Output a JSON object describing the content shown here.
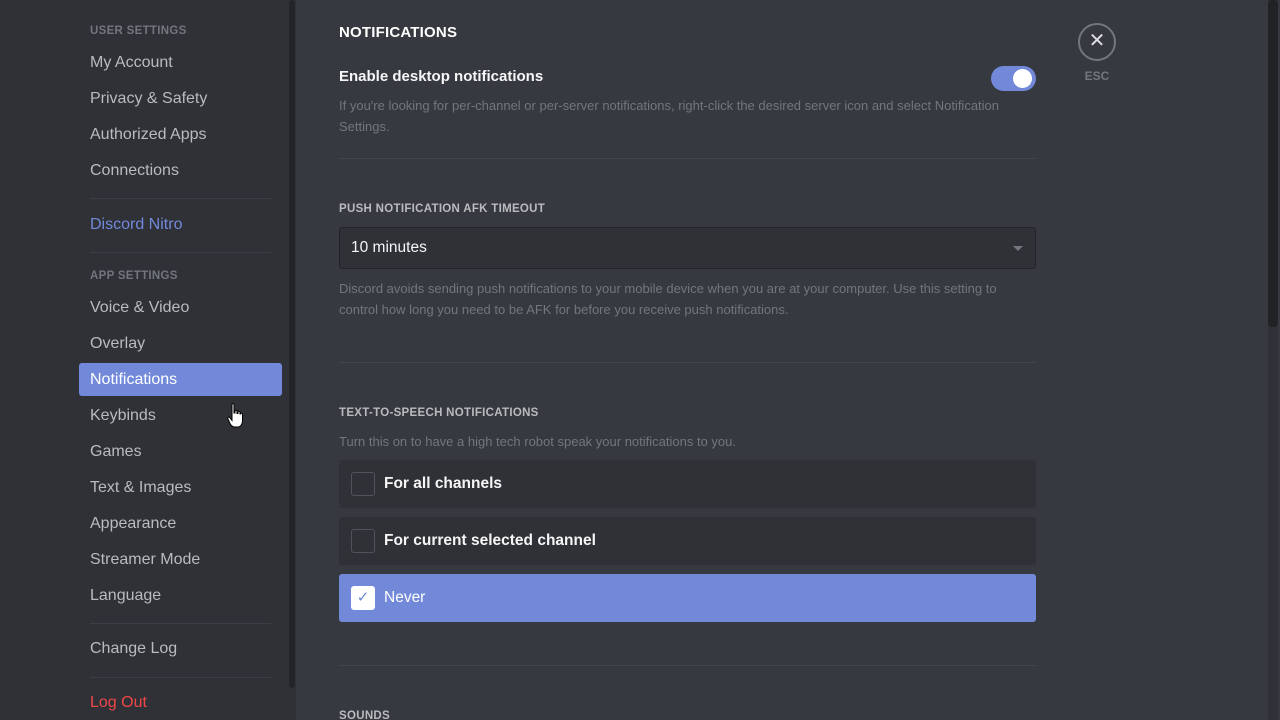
{
  "sidebar": {
    "user_settings_header": "USER SETTINGS",
    "user_items": [
      {
        "label": "My Account"
      },
      {
        "label": "Privacy & Safety"
      },
      {
        "label": "Authorized Apps"
      },
      {
        "label": "Connections"
      }
    ],
    "nitro_label": "Discord Nitro",
    "app_settings_header": "APP SETTINGS",
    "app_items": [
      {
        "label": "Voice & Video"
      },
      {
        "label": "Overlay"
      },
      {
        "label": "Notifications",
        "active": true
      },
      {
        "label": "Keybinds"
      },
      {
        "label": "Games"
      },
      {
        "label": "Text & Images"
      },
      {
        "label": "Appearance"
      },
      {
        "label": "Streamer Mode"
      },
      {
        "label": "Language"
      }
    ],
    "change_log_label": "Change Log",
    "logout_label": "Log Out"
  },
  "main": {
    "title": "NOTIFICATIONS",
    "desktop_notifications": {
      "label": "Enable desktop notifications",
      "enabled": true,
      "description": "If you're looking for per-channel or per-server notifications, right-click the desired server icon and select Notification Settings."
    },
    "afk_timeout": {
      "label": "PUSH NOTIFICATION AFK TIMEOUT",
      "value": "10 minutes",
      "description": "Discord avoids sending push notifications to your mobile device when you are at your computer. Use this setting to control how long you need to be AFK for before you receive push notifications."
    },
    "tts": {
      "label": "TEXT-TO-SPEECH NOTIFICATIONS",
      "description": "Turn this on to have a high tech robot speak your notifications to you.",
      "options": [
        {
          "label": "For all channels",
          "selected": false
        },
        {
          "label": "For current selected channel",
          "selected": false
        },
        {
          "label": "Never",
          "selected": true
        }
      ]
    },
    "sounds_label": "SOUNDS"
  },
  "close": {
    "icon": "close-icon",
    "glyph": "✕",
    "esc_label": "ESC"
  },
  "icons": {
    "check": "✓"
  },
  "colors": {
    "accent": "#7289da",
    "danger": "#f04747",
    "sidebar_bg": "#2f3136",
    "content_bg": "#36393f"
  }
}
